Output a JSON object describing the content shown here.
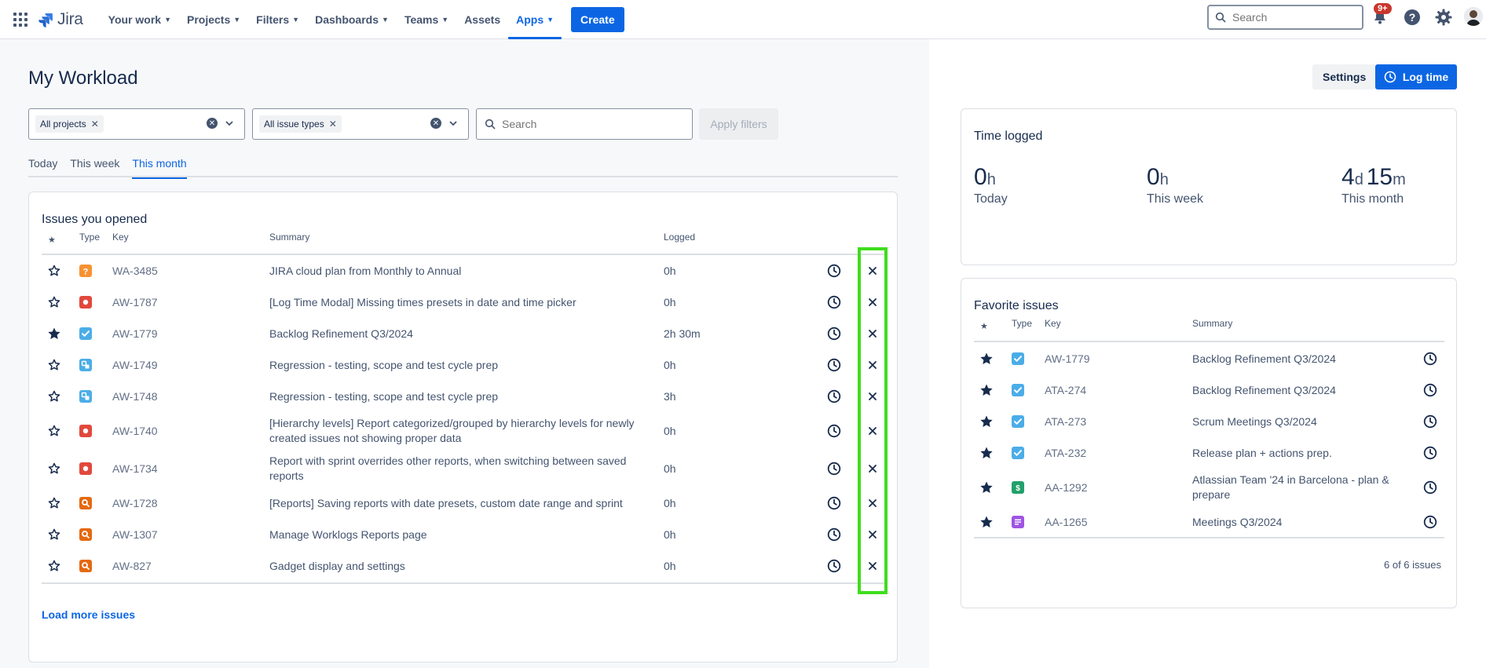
{
  "nav": {
    "logo": "Jira",
    "items": [
      {
        "label": "Your work",
        "dropdown": true,
        "active": false
      },
      {
        "label": "Projects",
        "dropdown": true,
        "active": false
      },
      {
        "label": "Filters",
        "dropdown": true,
        "active": false
      },
      {
        "label": "Dashboards",
        "dropdown": true,
        "active": false
      },
      {
        "label": "Teams",
        "dropdown": true,
        "active": false
      },
      {
        "label": "Assets",
        "dropdown": false,
        "active": false
      },
      {
        "label": "Apps",
        "dropdown": true,
        "active": true
      }
    ],
    "create_label": "Create",
    "search_placeholder": "Search",
    "notification_badge": "9+"
  },
  "page": {
    "title": "My Workload",
    "settings_label": "Settings",
    "log_time_label": "Log time"
  },
  "filters": {
    "projects_chip": "All projects",
    "types_chip": "All issue types",
    "search_placeholder": "Search",
    "apply_label": "Apply filters"
  },
  "tabs": [
    {
      "label": "Today",
      "active": false
    },
    {
      "label": "This week",
      "active": false
    },
    {
      "label": "This month",
      "active": true
    }
  ],
  "opened": {
    "title": "Issues you opened",
    "headers": {
      "type": "Type",
      "key": "Key",
      "summary": "Summary",
      "logged": "Logged"
    },
    "rows": [
      {
        "starred": false,
        "type": "question",
        "key": "WA-3485",
        "summary": "JIRA cloud plan from Monthly to Annual",
        "logged": "0h"
      },
      {
        "starred": false,
        "type": "bug",
        "key": "AW-1787",
        "summary": "[Log Time Modal] Missing times presets in date and time picker",
        "logged": "0h"
      },
      {
        "starred": true,
        "type": "task",
        "key": "AW-1779",
        "summary": "Backlog Refinement Q3/2024",
        "logged": "2h 30m"
      },
      {
        "starred": false,
        "type": "subtask",
        "key": "AW-1749",
        "summary": "Regression - testing, scope and test cycle prep",
        "logged": "0h"
      },
      {
        "starred": false,
        "type": "subtask",
        "key": "AW-1748",
        "summary": "Regression - testing, scope and test cycle prep",
        "logged": "3h"
      },
      {
        "starred": false,
        "type": "bug",
        "key": "AW-1740",
        "summary": "[Hierarchy levels] Report categorized/grouped by hierarchy levels for newly created issues not showing proper data",
        "logged": "0h"
      },
      {
        "starred": false,
        "type": "bug",
        "key": "AW-1734",
        "summary": "Report with sprint overrides other reports, when switching between saved reports",
        "logged": "0h"
      },
      {
        "starred": false,
        "type": "research",
        "key": "AW-1728",
        "summary": "[Reports] Saving reports with date presets, custom date range and sprint",
        "logged": "0h"
      },
      {
        "starred": false,
        "type": "research",
        "key": "AW-1307",
        "summary": "Manage Worklogs Reports page",
        "logged": "0h"
      },
      {
        "starred": false,
        "type": "research",
        "key": "AW-827",
        "summary": "Gadget display and settings",
        "logged": "0h"
      }
    ],
    "load_more": "Load more issues"
  },
  "time_logged": {
    "title": "Time logged",
    "stats": [
      {
        "value": "0",
        "unit": "h",
        "label": "Today"
      },
      {
        "value": "0",
        "unit": "h",
        "label": "This week"
      },
      {
        "value": "4",
        "unit": "d",
        "value2": "15",
        "unit2": "m",
        "label": "This month"
      }
    ]
  },
  "favorites": {
    "title": "Favorite issues",
    "headers": {
      "type": "Type",
      "key": "Key",
      "summary": "Summary"
    },
    "rows": [
      {
        "type": "task",
        "key": "AW-1779",
        "summary": "Backlog Refinement Q3/2024"
      },
      {
        "type": "task",
        "key": "ATA-274",
        "summary": "Backlog Refinement Q3/2024"
      },
      {
        "type": "task",
        "key": "ATA-273",
        "summary": "Scrum Meetings Q3/2024"
      },
      {
        "type": "task",
        "key": "ATA-232",
        "summary": "Release plan + actions prep."
      },
      {
        "type": "story",
        "key": "AA-1292",
        "summary": "Atlassian Team '24 in Barcelona - plan & prepare"
      },
      {
        "type": "meeting",
        "key": "AA-1265",
        "summary": "Meetings Q3/2024"
      }
    ],
    "count": "6 of 6 issues"
  },
  "colors": {
    "accent": "#0c66e4",
    "highlight": "#3fdd1c",
    "bug": "#e2483d",
    "question": "#f79233",
    "task": "#4bade8",
    "research": "#e56910",
    "story": "#22a06b",
    "meeting": "#9f55e3"
  }
}
